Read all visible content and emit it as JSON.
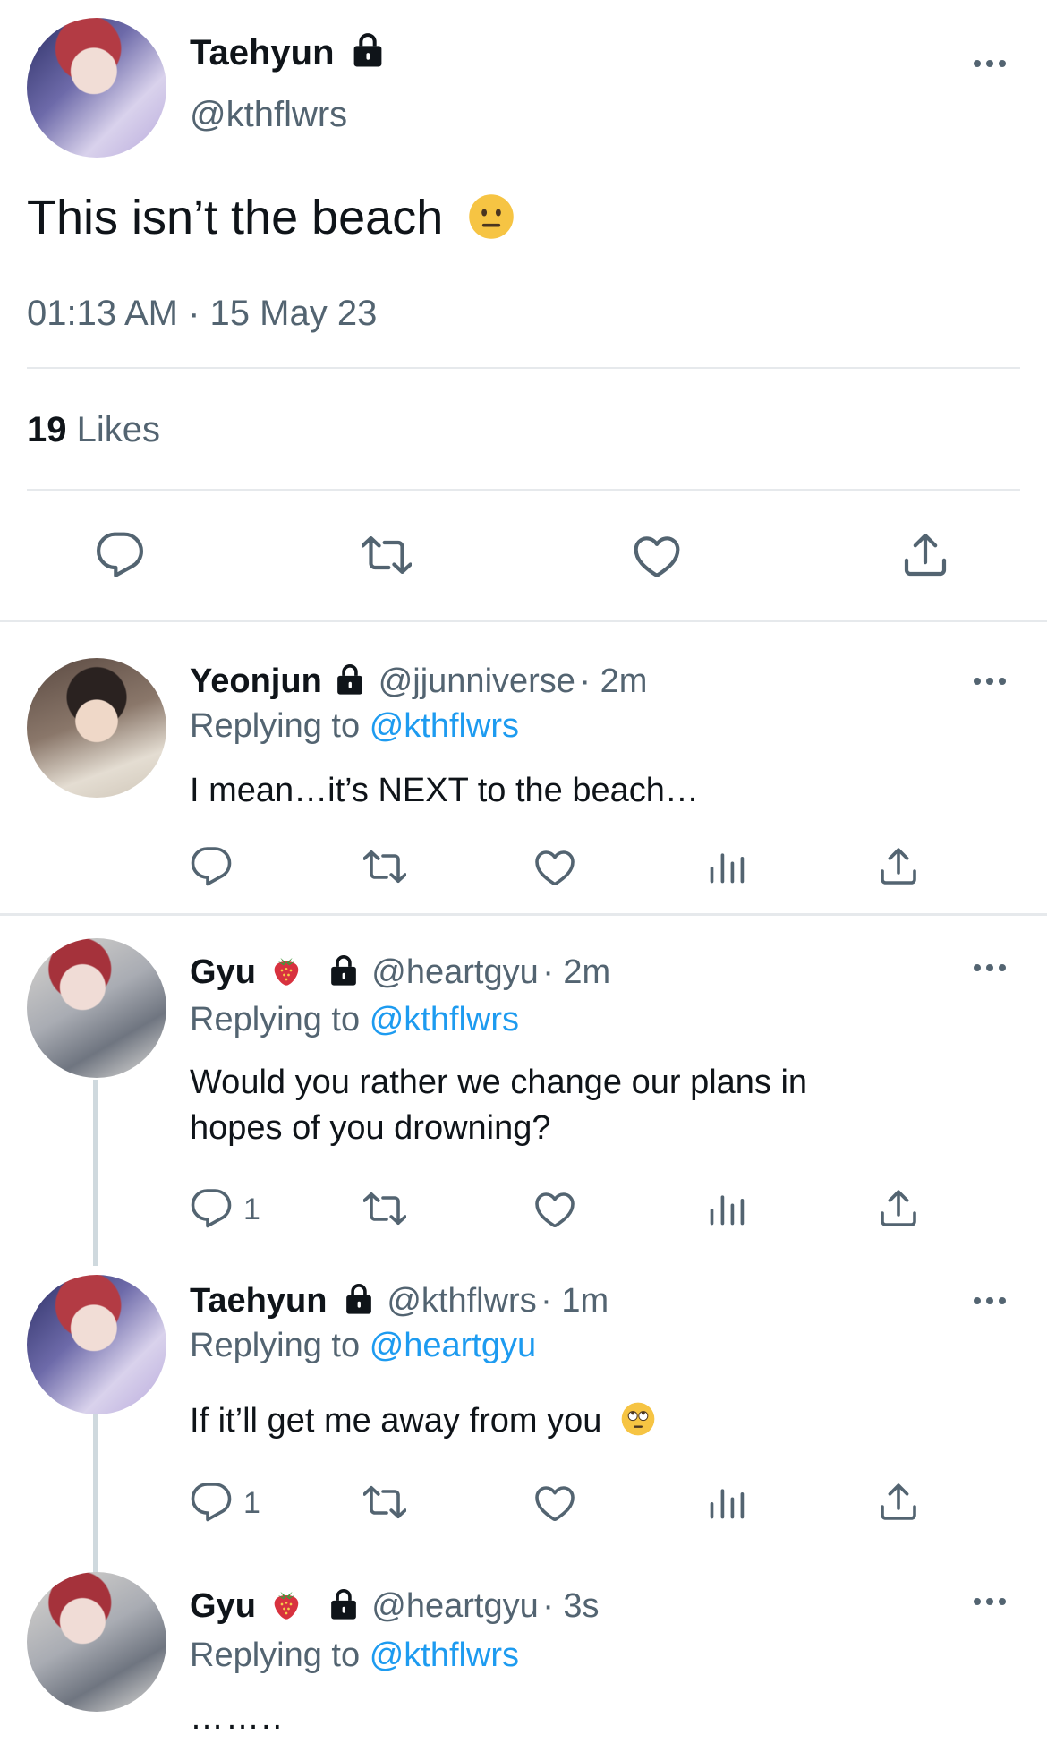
{
  "main_tweet": {
    "author_name": "Taehyun",
    "handle": "@kthflwrs",
    "text": "This isn’t the beach",
    "emoji": "neutral-face",
    "timestamp": "01:13 AM · 15 May 23",
    "likes_count": "19",
    "likes_label": "Likes"
  },
  "replies": [
    {
      "author_name": "Yeonjun",
      "handle": "@jjunniverse",
      "time": "· 2m",
      "replying_prefix": "Replying to",
      "replying_handle": "@kthflwrs",
      "text": "I mean…it’s NEXT to the beach…"
    },
    {
      "author_name": "Gyu",
      "handle": "@heartgyu",
      "time": "· 2m",
      "replying_prefix": "Replying to",
      "replying_handle": "@kthflwrs",
      "text_line1": "Would you rather we change our plans in",
      "text_line2": "hopes of you drowning?",
      "reply_count": "1"
    },
    {
      "author_name": "Taehyun",
      "handle": "@kthflwrs",
      "time": "· 1m",
      "replying_prefix": "Replying to",
      "replying_handle": "@heartgyu",
      "text": "If it’ll get me away from you",
      "emoji": "eye-roll-face",
      "reply_count": "1"
    },
    {
      "author_name": "Gyu",
      "handle": "@heartgyu",
      "time": "· 3s",
      "replying_prefix": "Replying to",
      "replying_handle": "@kthflwrs",
      "text": "……..",
      "emoji": "strawberry"
    }
  ],
  "colors": {
    "accent": "#1d9bf0",
    "text": "#0f1419",
    "muted": "#536471",
    "divider": "#e6e9ec"
  }
}
